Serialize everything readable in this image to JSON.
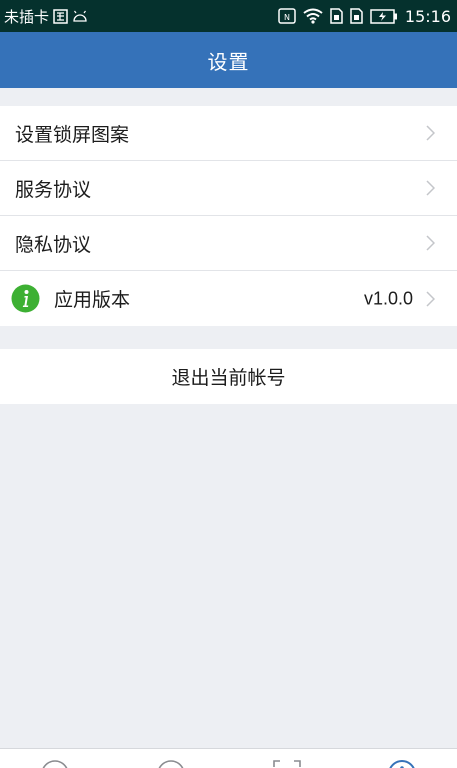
{
  "status_bar": {
    "carrier": "未插卡",
    "time": "15:16",
    "icons": [
      "sim-card-icon",
      "android-icon",
      "nfc-icon",
      "wifi-icon",
      "sim-slot-1-icon",
      "sim-slot-2-icon",
      "battery-charging-icon"
    ]
  },
  "header": {
    "title": "设置"
  },
  "settings": {
    "items": [
      {
        "label": "设置锁屏图案"
      },
      {
        "label": "服务协议"
      },
      {
        "label": "隐私协议"
      },
      {
        "label": "应用版本",
        "value": "v1.0.0",
        "icon": "info-icon"
      }
    ]
  },
  "logout": {
    "label": "退出当前帐号"
  },
  "tab_bar": {
    "icons": [
      "home-tab-icon",
      "discover-tab-icon",
      "scan-tab-icon",
      "settings-tab-icon"
    ],
    "active_index": 3
  },
  "colors": {
    "status_bar": "#05312d",
    "header": "#3572b9",
    "background": "#edeff3",
    "info_icon": "#3db033",
    "active_tab": "#3572b9"
  }
}
